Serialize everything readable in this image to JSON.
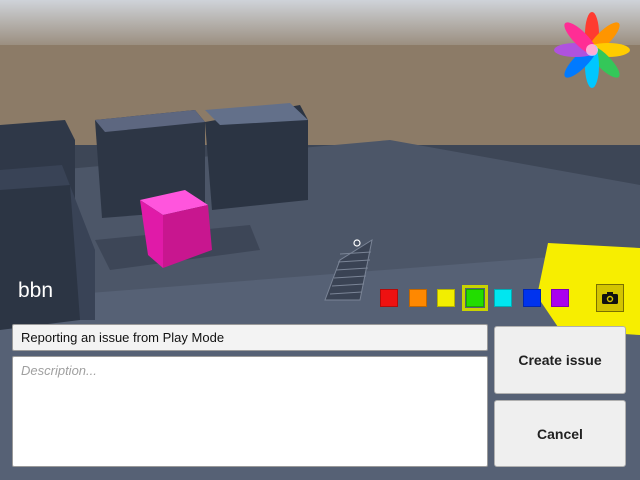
{
  "scene": {
    "player_name": "bbn",
    "sky_top": "#c7ccd3",
    "ground_color": "#8a7a66",
    "platform_color": "#4a5568",
    "cube_color": "#ff22cc",
    "highlight_color": "#ffee00"
  },
  "palette": {
    "colors": [
      "#ee1111",
      "#ff8800",
      "#f2ee00",
      "#22dd00",
      "#00e6f0",
      "#0033ee",
      "#aa00ee"
    ],
    "selected_index": 3
  },
  "toolbar": {
    "camera_icon": "camera-icon"
  },
  "form": {
    "title_value": "Reporting an issue from Play Mode",
    "description_placeholder": "Description...",
    "create_label": "Create issue",
    "cancel_label": "Cancel"
  }
}
